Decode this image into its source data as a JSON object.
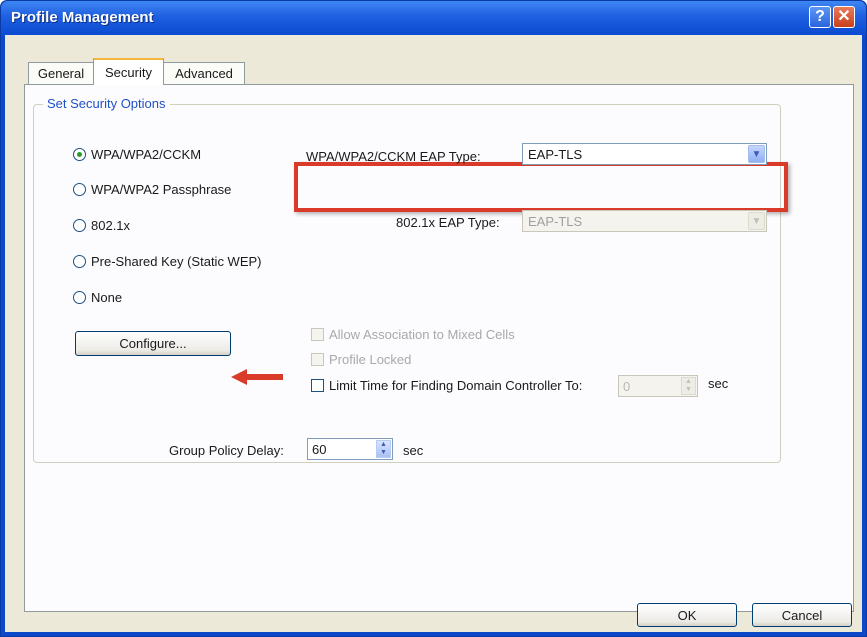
{
  "window": {
    "title": "Profile Management",
    "help_glyph": "?",
    "close_glyph": "✕"
  },
  "tabs": [
    {
      "label": "General"
    },
    {
      "label": "Security"
    },
    {
      "label": "Advanced"
    }
  ],
  "security": {
    "group_title": "Set Security Options",
    "options": [
      {
        "label": "WPA/WPA2/CCKM",
        "selected": true
      },
      {
        "label": "WPA/WPA2 Passphrase",
        "selected": false
      },
      {
        "label": "802.1x",
        "selected": false
      },
      {
        "label": "Pre-Shared Key (Static WEP)",
        "selected": false
      },
      {
        "label": "None",
        "selected": false
      }
    ],
    "wpa_eap_label": "WPA/WPA2/CCKM EAP Type:",
    "wpa_eap_value": "EAP-TLS",
    "dot1x_eap_label": "802.1x EAP Type:",
    "dot1x_eap_value": "EAP-TLS",
    "configure_label": "Configure...",
    "allow_mixed_label": "Allow Association to Mixed Cells",
    "profile_locked_label": "Profile Locked",
    "limit_time_label": "Limit Time for Finding Domain Controller To:",
    "limit_time_value": "0",
    "limit_time_unit": "sec",
    "group_policy_label": "Group Policy Delay:",
    "group_policy_value": "60",
    "group_policy_unit": "sec"
  },
  "buttons": {
    "ok": "OK",
    "cancel": "Cancel"
  },
  "icons": {
    "dropdown": "▼",
    "spin_up": "▲",
    "spin_down": "▼"
  },
  "colors": {
    "highlight": "#d93a2a",
    "titlebar": "#0b4bd2"
  }
}
